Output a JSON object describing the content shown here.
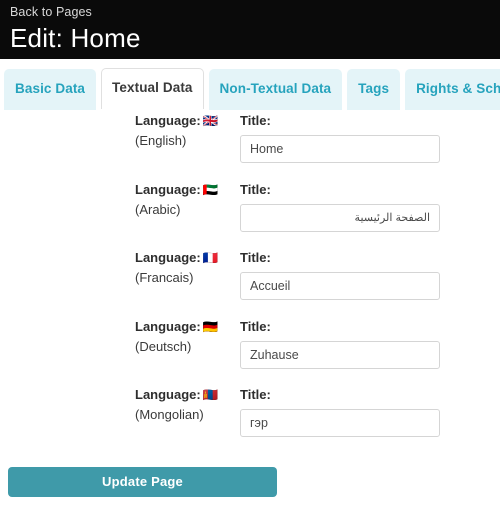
{
  "header": {
    "back_link": "Back to Pages",
    "title": "Edit: Home"
  },
  "tabs": [
    {
      "label": "Basic Data",
      "active": false
    },
    {
      "label": "Textual Data",
      "active": true
    },
    {
      "label": "Non-Textual Data",
      "active": false
    },
    {
      "label": "Tags",
      "active": false
    },
    {
      "label": "Rights & Scheduling",
      "active": false
    }
  ],
  "labels": {
    "language_label": "Language:",
    "title_label": "Title:"
  },
  "rows": [
    {
      "flag": "🇬🇧",
      "flag_icon": "flag-united-kingdom-icon",
      "language_name": "(English)",
      "title_label": "Title:",
      "title_value": "Home",
      "rtl": false
    },
    {
      "flag": "🇦🇪",
      "flag_icon": "flag-united-arab-emirates-icon",
      "language_name": "(Arabic)",
      "title_label": "Title:",
      "title_value": "الصفحة الرئيسية",
      "rtl": true
    },
    {
      "flag": "🇫🇷",
      "flag_icon": "flag-france-icon",
      "language_name": "(Francais)",
      "title_label": "Title:",
      "title_value": "Accueil",
      "rtl": false
    },
    {
      "flag": "🇩🇪",
      "flag_icon": "flag-germany-icon",
      "language_name": "(Deutsch)",
      "title_label": "Title:",
      "title_value": "Zuhause",
      "rtl": false
    },
    {
      "flag": "🇲🇳",
      "flag_icon": "flag-mongolia-icon",
      "language_name": "(Mongolian)",
      "title_label": "Title:",
      "title_value": "гэр",
      "rtl": false
    }
  ],
  "footer": {
    "submit_label": "Update Page"
  },
  "colors": {
    "header_bg": "#0a0a0a",
    "tab_inactive_bg": "#e4f4f8",
    "tab_inactive_text": "#26a3bd",
    "accent_teal": "#3f9aa9",
    "input_border": "#d5d5d5"
  }
}
